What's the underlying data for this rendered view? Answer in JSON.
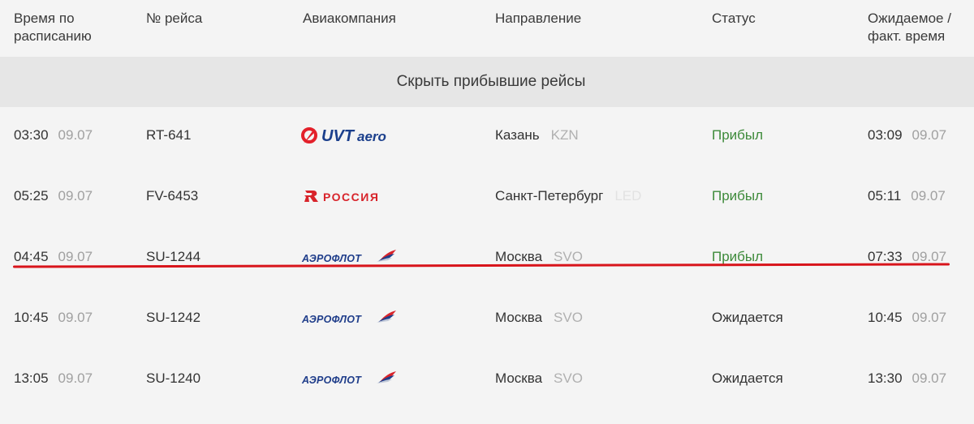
{
  "header": {
    "sched_time": "Время по расписанию",
    "flight_no": "№ рейса",
    "airline": "Авиакомпания",
    "direction": "Направление",
    "status": "Статус",
    "actual_time": "Ожидаемое / факт. время"
  },
  "toggle_label": "Скрыть прибывшие рейсы",
  "colors": {
    "arrived_status": "#3d8a3a",
    "highlight_line": "#d8141b",
    "aeroflot_blue": "#1f3d8a",
    "rossiya_red": "#d8232a",
    "uvt_red": "#e3202a",
    "uvt_blue": "#1b3f8c"
  },
  "flights": [
    {
      "sched_time": "03:30",
      "sched_date": "09.07",
      "flight_no": "RT-641",
      "airline_logo": "uvt-aero-logo",
      "logo_text_1": "UVT",
      "logo_text_2": "aero",
      "city": "Казань",
      "code": "KZN",
      "status": "Прибыл",
      "status_type": "arrived",
      "actual_time": "03:09",
      "actual_date": "09.07"
    },
    {
      "sched_time": "05:25",
      "sched_date": "09.07",
      "flight_no": "FV-6453",
      "airline_logo": "rossiya-logo",
      "logo_text_1": "РОССИЯ",
      "city": "Санкт-Петербург",
      "code": "LED",
      "status": "Прибыл",
      "status_type": "arrived",
      "actual_time": "05:11",
      "actual_date": "09.07"
    },
    {
      "sched_time": "04:45",
      "sched_date": "09.07",
      "flight_no": "SU-1244",
      "airline_logo": "aeroflot-logo",
      "logo_text_1": "АЭРОФЛОТ",
      "city": "Москва",
      "code": "SVO",
      "status": "Прибыл",
      "status_type": "arrived",
      "actual_time": "07:33",
      "actual_date": "09.07"
    },
    {
      "sched_time": "10:45",
      "sched_date": "09.07",
      "flight_no": "SU-1242",
      "airline_logo": "aeroflot-logo",
      "logo_text_1": "АЭРОФЛОТ",
      "city": "Москва",
      "code": "SVO",
      "status": "Ожидается",
      "status_type": "expected",
      "actual_time": "10:45",
      "actual_date": "09.07"
    },
    {
      "sched_time": "13:05",
      "sched_date": "09.07",
      "flight_no": "SU-1240",
      "airline_logo": "aeroflot-logo",
      "logo_text_1": "АЭРОФЛОТ",
      "city": "Москва",
      "code": "SVO",
      "status": "Ожидается",
      "status_type": "expected",
      "actual_time": "13:30",
      "actual_date": "09.07"
    }
  ]
}
